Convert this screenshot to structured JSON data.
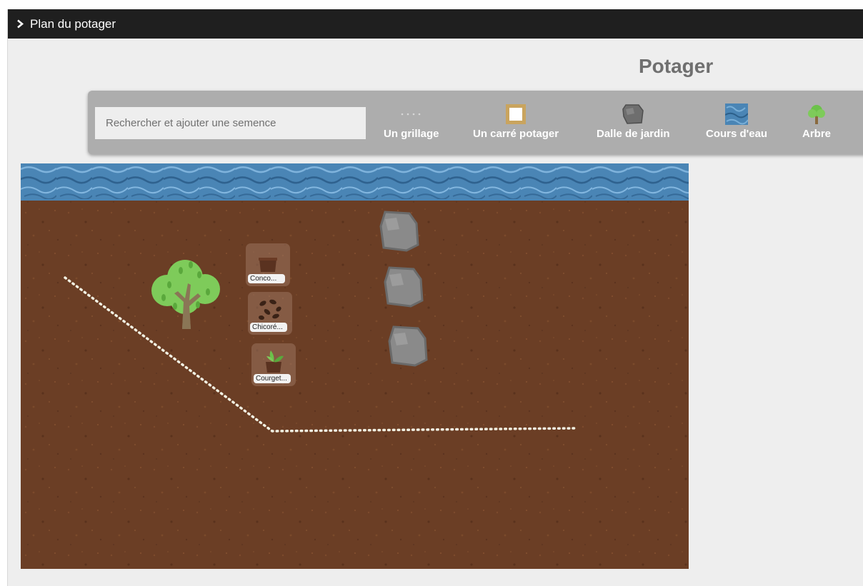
{
  "header": {
    "chevron_icon": "chevron-right-icon",
    "title": "Plan du potager"
  },
  "main": {
    "title": "Potager"
  },
  "toolbar": {
    "search_placeholder": "Rechercher et ajouter une semence",
    "tools": [
      {
        "label": "Un grillage",
        "icon": "fence-icon"
      },
      {
        "label": "Un carré potager",
        "icon": "raised-bed-icon"
      },
      {
        "label": "Dalle de jardin",
        "icon": "paving-stone-icon"
      },
      {
        "label": "Cours d'eau",
        "icon": "water-icon"
      },
      {
        "label": "Arbre",
        "icon": "tree-icon"
      }
    ]
  },
  "garden": {
    "plants": [
      {
        "label": "Conco...",
        "icon": "cucumber-seed-icon"
      },
      {
        "label": "Chicoré...",
        "icon": "chicory-seed-icon"
      },
      {
        "label": "Courget...",
        "icon": "zucchini-plant-icon"
      }
    ],
    "colors": {
      "soil": "#6b3e25",
      "water": "#4a85b5",
      "tree": "#7ecb5a",
      "stone": "#8a8a8a",
      "fence": "#f1f0e2",
      "header": "#1f1f1f",
      "toolbar": "#adadad"
    }
  }
}
